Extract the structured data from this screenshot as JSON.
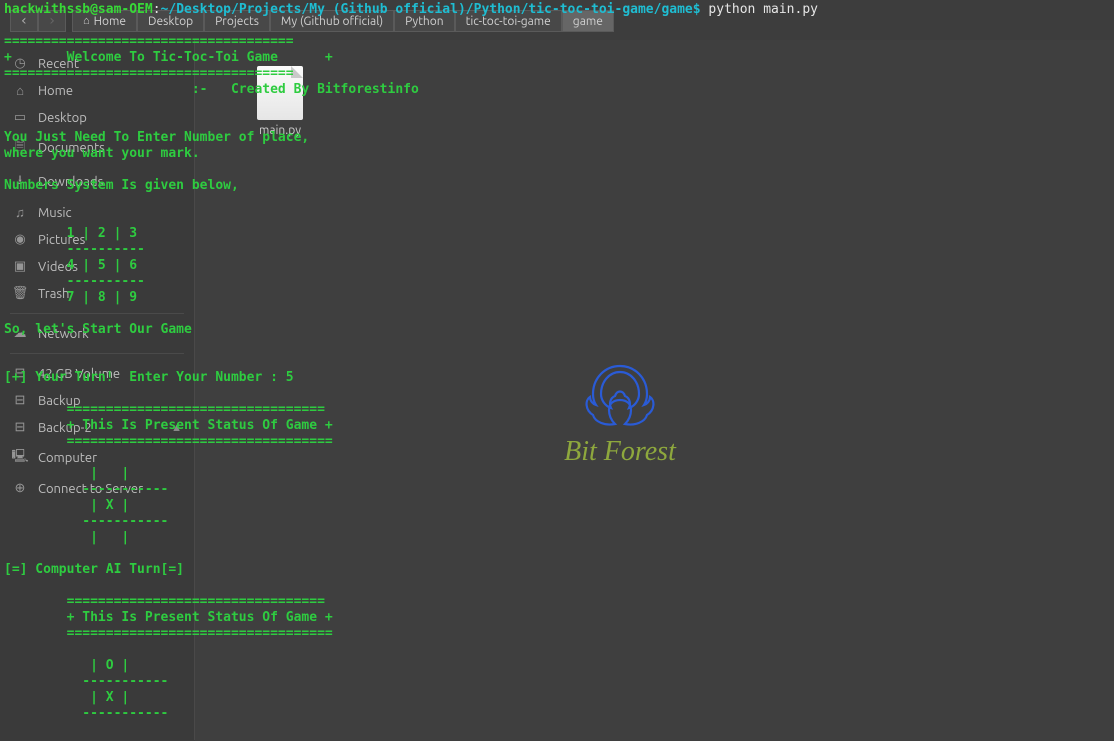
{
  "prompt": {
    "user": "hackwithssb@sam-OEM",
    "sep": ":",
    "path": "~/Desktop/Projects/My (Github official)/Python/tic-toc-toi-game/game",
    "dollar": "$",
    "command": " python main.py"
  },
  "breadcrumb": {
    "home": "Home",
    "items": [
      "Desktop",
      "Projects",
      "My (Github official)",
      "Python",
      "tic-toc-toi-game",
      "game"
    ]
  },
  "sidebar": {
    "recent": "Recent",
    "home": "Home",
    "desktop": "Desktop",
    "documents": "Documents",
    "downloads": "Downloads",
    "music": "Music",
    "pictures": "Pictures",
    "videos": "Videos",
    "trash": "Trash",
    "network": "Network",
    "vol": "42 GB Volume",
    "backup": "Backup",
    "backup2": "Backup-2",
    "computer": "Computer",
    "connect": "Connect to Server"
  },
  "file": {
    "name": "main.py"
  },
  "watermark": {
    "text": "Bit Forest"
  },
  "term": {
    "divider1": "=====================================",
    "welcome": "+       Welcome To Tic-Toc-Toi Game      +",
    "divider2": "=====================================",
    "credit": "                        :-   Created By Bitforestinfo",
    "blank": "",
    "help1": "You Just Need To Enter Number of place,",
    "help2": "where you want your mark.",
    "blank2": "",
    "numsys": "Numbers System Is given below,",
    "blank3": "",
    "blank4": "",
    "grid1": "        1 | 2 | 3",
    "grid1s": "        ----------",
    "grid2": "        4 | 5 | 6",
    "grid2s": "        ----------",
    "grid3": "        7 | 8 | 9",
    "blank5": "",
    "start": "So, let's Start Our Game",
    "blank6": "",
    "blank7": "",
    "turn": "[+] Your Turn!  Enter Your Number : 5",
    "blank8": "",
    "sdiv1": "        =================================",
    "status": "        + This Is Present Status Of Game +",
    "sdiv2": "        ==================================",
    "blank9": "",
    "b1": "           |   |",
    "b1s": "          -----------",
    "b2": "           | X |",
    "b2s": "          -----------",
    "b3": "           |   |",
    "blank10": "",
    "ai": "[=] Computer AI Turn[=]",
    "blank11": "",
    "sdiv3": "        =================================",
    "status2": "        + This Is Present Status Of Game +",
    "sdiv4": "        ==================================",
    "blank12": "",
    "c1": "           | O |",
    "c1s": "          -----------",
    "c2": "           | X |",
    "c2s": "          -----------"
  }
}
